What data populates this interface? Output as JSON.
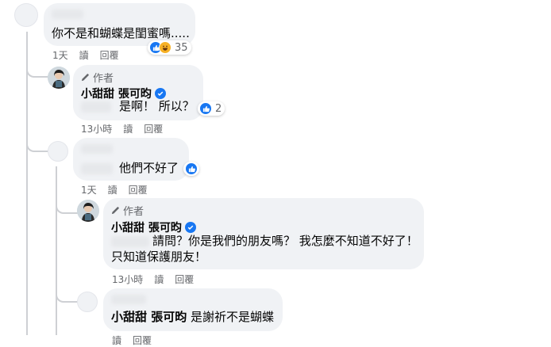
{
  "comments": [
    {
      "text": "你不是和蝴蝶是閨蜜嗎.....",
      "reactions_count": "35",
      "time": "1天",
      "read": "讀",
      "reply": "回覆"
    },
    {
      "author_tag": "作者",
      "name": "小甜甜 張可昀",
      "text": "是啊！ 所以？",
      "reactions_count": "2",
      "time": "13小時",
      "read": "讀",
      "reply": "回覆"
    },
    {
      "text": "他們不好了",
      "time": "1天",
      "read": "讀",
      "reply": "回覆"
    },
    {
      "author_tag": "作者",
      "name": "小甜甜 張可昀",
      "text_line1": "請問？你是我們的朋友嗎？ 我怎麼不知道不好了！",
      "text_line2": "只知道保護朋友！",
      "time": "13小時",
      "read": "讀",
      "reply": "回覆"
    },
    {
      "mention": "小甜甜 張可昀",
      "text": "是謝祈不是蝴蝶",
      "read": "讀",
      "reply": "回覆"
    }
  ],
  "colors": {
    "bubble": "#f0f2f5",
    "meta": "#65676b",
    "like": "#1877f2",
    "verified": "#1877f2"
  }
}
